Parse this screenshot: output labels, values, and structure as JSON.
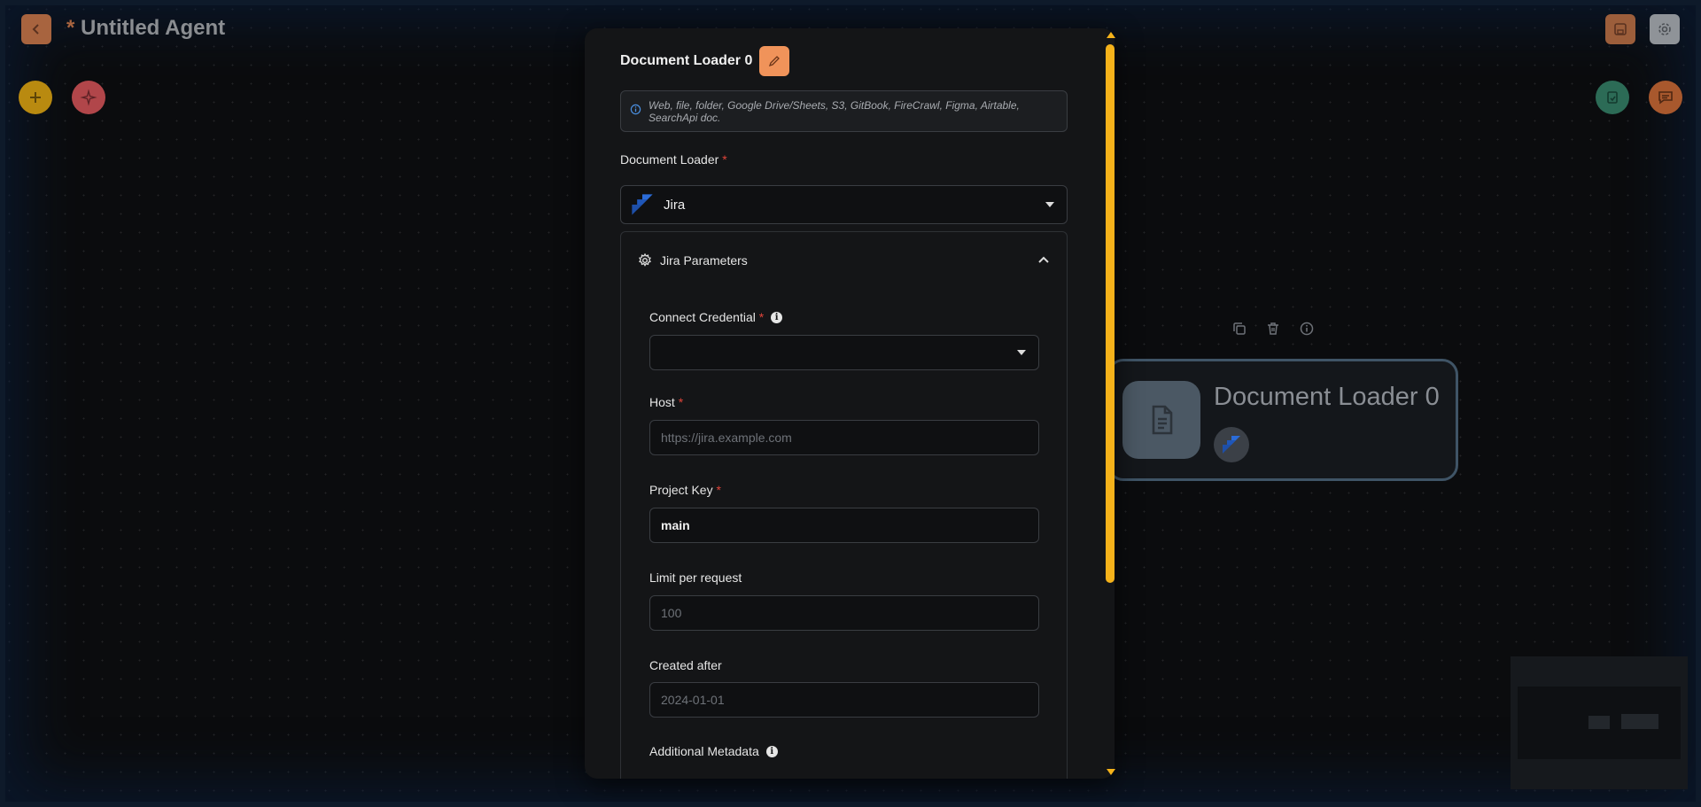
{
  "app": {
    "title_marker": "*",
    "title": "Untitled Agent"
  },
  "toolbar": {
    "back_icon": "chevron-left-icon",
    "save_icon": "save-icon",
    "settings_icon": "gear-icon"
  },
  "fabs": {
    "add_icon": "plus-icon",
    "magic_icon": "sparkles-icon",
    "validate_icon": "checklist-icon",
    "chat_icon": "chat-icon"
  },
  "panel": {
    "title": "Document Loader 0",
    "description": "Web, file, folder, Google Drive/Sheets, S3, GitBook, FireCrawl, Figma, Airtable, SearchApi doc.",
    "loader_label": "Document Loader",
    "loader_required": "*",
    "loader_selected": "Jira",
    "params_title": "Jira Parameters",
    "fields": {
      "credential": {
        "label": "Connect Credential",
        "required": "*",
        "value": ""
      },
      "host": {
        "label": "Host",
        "required": "*",
        "placeholder": "https://jira.example.com"
      },
      "project_key": {
        "label": "Project Key",
        "required": "*",
        "value": "main"
      },
      "limit": {
        "label": "Limit per request",
        "placeholder": "100"
      },
      "created_after": {
        "label": "Created after",
        "placeholder": "2024-01-01"
      },
      "metadata": {
        "label": "Additional Metadata"
      }
    }
  },
  "node": {
    "title": "Document Loader 0",
    "toolbar_icons": [
      "copy-icon",
      "trash-icon",
      "info-icon"
    ]
  },
  "colors": {
    "accent_orange": "#f0935a",
    "scrollbar": "#f5b21a",
    "required": "#e0443a"
  }
}
